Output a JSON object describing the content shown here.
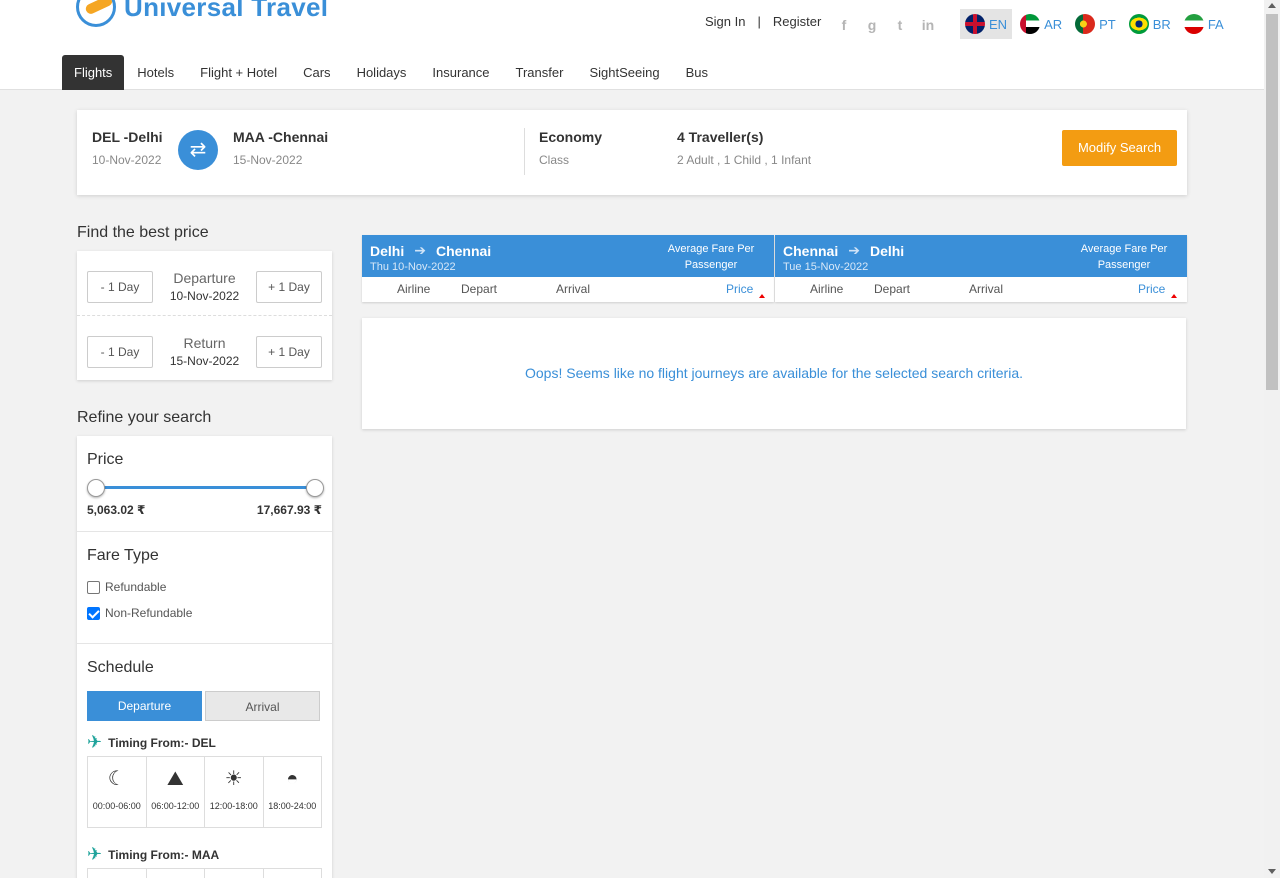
{
  "brand": {
    "name": "Universal Travel"
  },
  "top_links": {
    "sign_in": "Sign In",
    "separator": "|",
    "register": "Register"
  },
  "social": [
    "f",
    "g",
    "t",
    "in"
  ],
  "languages": [
    {
      "code": "EN",
      "flag": "uk-flag-icon",
      "active": true
    },
    {
      "code": "AR",
      "flag": "uae-flag-icon"
    },
    {
      "code": "PT",
      "flag": "portugal-flag-icon"
    },
    {
      "code": "BR",
      "flag": "brazil-flag-icon"
    },
    {
      "code": "FA",
      "flag": "iran-flag-icon"
    }
  ],
  "nav": [
    "Flights",
    "Hotels",
    "Flight + Hotel",
    "Cars",
    "Holidays",
    "Insurance",
    "Transfer",
    "SightSeeing",
    "Bus"
  ],
  "search": {
    "from_code": "DEL -Delhi",
    "from_date": "10-Nov-2022",
    "to_code": "MAA -Chennai",
    "to_date": "15-Nov-2022",
    "class_value": "Economy",
    "class_label": "Class",
    "travellers": "4 Traveller(s)",
    "travellers_detail": "2 Adult , 1 Child , 1 Infant",
    "modify": "Modify Search"
  },
  "best_price": {
    "heading": "Find the best price",
    "minus": "- 1 Day",
    "plus": "+ 1 Day",
    "departure_label": "Departure",
    "departure_date": "10-Nov-2022",
    "return_label": "Return",
    "return_date": "15-Nov-2022"
  },
  "refine": {
    "heading": "Refine your search",
    "price_title": "Price",
    "price_min": "5,063.02 ₹",
    "price_max": "17,667.93 ₹",
    "fare_type_title": "Fare Type",
    "refundable": "Refundable",
    "non_refundable": "Non-Refundable",
    "schedule_title": "Schedule",
    "tab_departure": "Departure",
    "tab_arrival": "Arrival",
    "timing_del": "Timing From:- DEL",
    "timing_maa": "Timing From:- MAA",
    "slots": [
      "00:00-06:00",
      "06:00-12:00",
      "12:00-18:00",
      "18:00-24:00"
    ]
  },
  "results": {
    "outbound": {
      "from": "Delhi",
      "to": "Chennai",
      "date": "Thu 10-Nov-2022"
    },
    "inbound": {
      "from": "Chennai",
      "to": "Delhi",
      "date": "Tue 15-Nov-2022"
    },
    "avg_fare": "Average Fare Per Passenger",
    "col_airline": "Airline",
    "col_depart": "Depart",
    "col_arrival": "Arrival",
    "col_price": "Price",
    "empty_message": "Oops! Seems like no flight journeys are available for the selected search criteria."
  },
  "colors": {
    "primary": "#3a8fd8",
    "accent": "#f39c12",
    "nav_active": "#333333"
  }
}
